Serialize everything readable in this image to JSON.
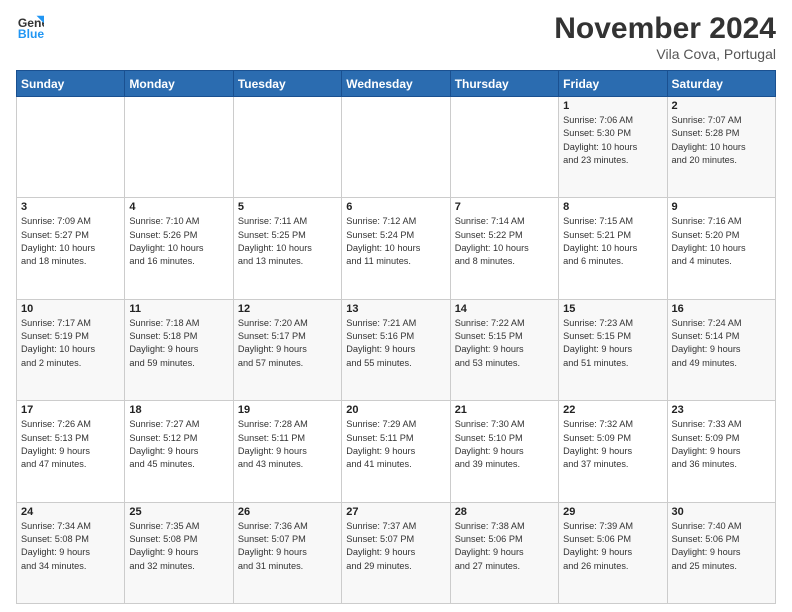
{
  "logo": {
    "line1": "General",
    "line2": "Blue"
  },
  "title": "November 2024",
  "location": "Vila Cova, Portugal",
  "days_of_week": [
    "Sunday",
    "Monday",
    "Tuesday",
    "Wednesday",
    "Thursday",
    "Friday",
    "Saturday"
  ],
  "weeks": [
    [
      {
        "day": "",
        "info": ""
      },
      {
        "day": "",
        "info": ""
      },
      {
        "day": "",
        "info": ""
      },
      {
        "day": "",
        "info": ""
      },
      {
        "day": "",
        "info": ""
      },
      {
        "day": "1",
        "info": "Sunrise: 7:06 AM\nSunset: 5:30 PM\nDaylight: 10 hours\nand 23 minutes."
      },
      {
        "day": "2",
        "info": "Sunrise: 7:07 AM\nSunset: 5:28 PM\nDaylight: 10 hours\nand 20 minutes."
      }
    ],
    [
      {
        "day": "3",
        "info": "Sunrise: 7:09 AM\nSunset: 5:27 PM\nDaylight: 10 hours\nand 18 minutes."
      },
      {
        "day": "4",
        "info": "Sunrise: 7:10 AM\nSunset: 5:26 PM\nDaylight: 10 hours\nand 16 minutes."
      },
      {
        "day": "5",
        "info": "Sunrise: 7:11 AM\nSunset: 5:25 PM\nDaylight: 10 hours\nand 13 minutes."
      },
      {
        "day": "6",
        "info": "Sunrise: 7:12 AM\nSunset: 5:24 PM\nDaylight: 10 hours\nand 11 minutes."
      },
      {
        "day": "7",
        "info": "Sunrise: 7:14 AM\nSunset: 5:22 PM\nDaylight: 10 hours\nand 8 minutes."
      },
      {
        "day": "8",
        "info": "Sunrise: 7:15 AM\nSunset: 5:21 PM\nDaylight: 10 hours\nand 6 minutes."
      },
      {
        "day": "9",
        "info": "Sunrise: 7:16 AM\nSunset: 5:20 PM\nDaylight: 10 hours\nand 4 minutes."
      }
    ],
    [
      {
        "day": "10",
        "info": "Sunrise: 7:17 AM\nSunset: 5:19 PM\nDaylight: 10 hours\nand 2 minutes."
      },
      {
        "day": "11",
        "info": "Sunrise: 7:18 AM\nSunset: 5:18 PM\nDaylight: 9 hours\nand 59 minutes."
      },
      {
        "day": "12",
        "info": "Sunrise: 7:20 AM\nSunset: 5:17 PM\nDaylight: 9 hours\nand 57 minutes."
      },
      {
        "day": "13",
        "info": "Sunrise: 7:21 AM\nSunset: 5:16 PM\nDaylight: 9 hours\nand 55 minutes."
      },
      {
        "day": "14",
        "info": "Sunrise: 7:22 AM\nSunset: 5:15 PM\nDaylight: 9 hours\nand 53 minutes."
      },
      {
        "day": "15",
        "info": "Sunrise: 7:23 AM\nSunset: 5:15 PM\nDaylight: 9 hours\nand 51 minutes."
      },
      {
        "day": "16",
        "info": "Sunrise: 7:24 AM\nSunset: 5:14 PM\nDaylight: 9 hours\nand 49 minutes."
      }
    ],
    [
      {
        "day": "17",
        "info": "Sunrise: 7:26 AM\nSunset: 5:13 PM\nDaylight: 9 hours\nand 47 minutes."
      },
      {
        "day": "18",
        "info": "Sunrise: 7:27 AM\nSunset: 5:12 PM\nDaylight: 9 hours\nand 45 minutes."
      },
      {
        "day": "19",
        "info": "Sunrise: 7:28 AM\nSunset: 5:11 PM\nDaylight: 9 hours\nand 43 minutes."
      },
      {
        "day": "20",
        "info": "Sunrise: 7:29 AM\nSunset: 5:11 PM\nDaylight: 9 hours\nand 41 minutes."
      },
      {
        "day": "21",
        "info": "Sunrise: 7:30 AM\nSunset: 5:10 PM\nDaylight: 9 hours\nand 39 minutes."
      },
      {
        "day": "22",
        "info": "Sunrise: 7:32 AM\nSunset: 5:09 PM\nDaylight: 9 hours\nand 37 minutes."
      },
      {
        "day": "23",
        "info": "Sunrise: 7:33 AM\nSunset: 5:09 PM\nDaylight: 9 hours\nand 36 minutes."
      }
    ],
    [
      {
        "day": "24",
        "info": "Sunrise: 7:34 AM\nSunset: 5:08 PM\nDaylight: 9 hours\nand 34 minutes."
      },
      {
        "day": "25",
        "info": "Sunrise: 7:35 AM\nSunset: 5:08 PM\nDaylight: 9 hours\nand 32 minutes."
      },
      {
        "day": "26",
        "info": "Sunrise: 7:36 AM\nSunset: 5:07 PM\nDaylight: 9 hours\nand 31 minutes."
      },
      {
        "day": "27",
        "info": "Sunrise: 7:37 AM\nSunset: 5:07 PM\nDaylight: 9 hours\nand 29 minutes."
      },
      {
        "day": "28",
        "info": "Sunrise: 7:38 AM\nSunset: 5:06 PM\nDaylight: 9 hours\nand 27 minutes."
      },
      {
        "day": "29",
        "info": "Sunrise: 7:39 AM\nSunset: 5:06 PM\nDaylight: 9 hours\nand 26 minutes."
      },
      {
        "day": "30",
        "info": "Sunrise: 7:40 AM\nSunset: 5:06 PM\nDaylight: 9 hours\nand 25 minutes."
      }
    ]
  ]
}
